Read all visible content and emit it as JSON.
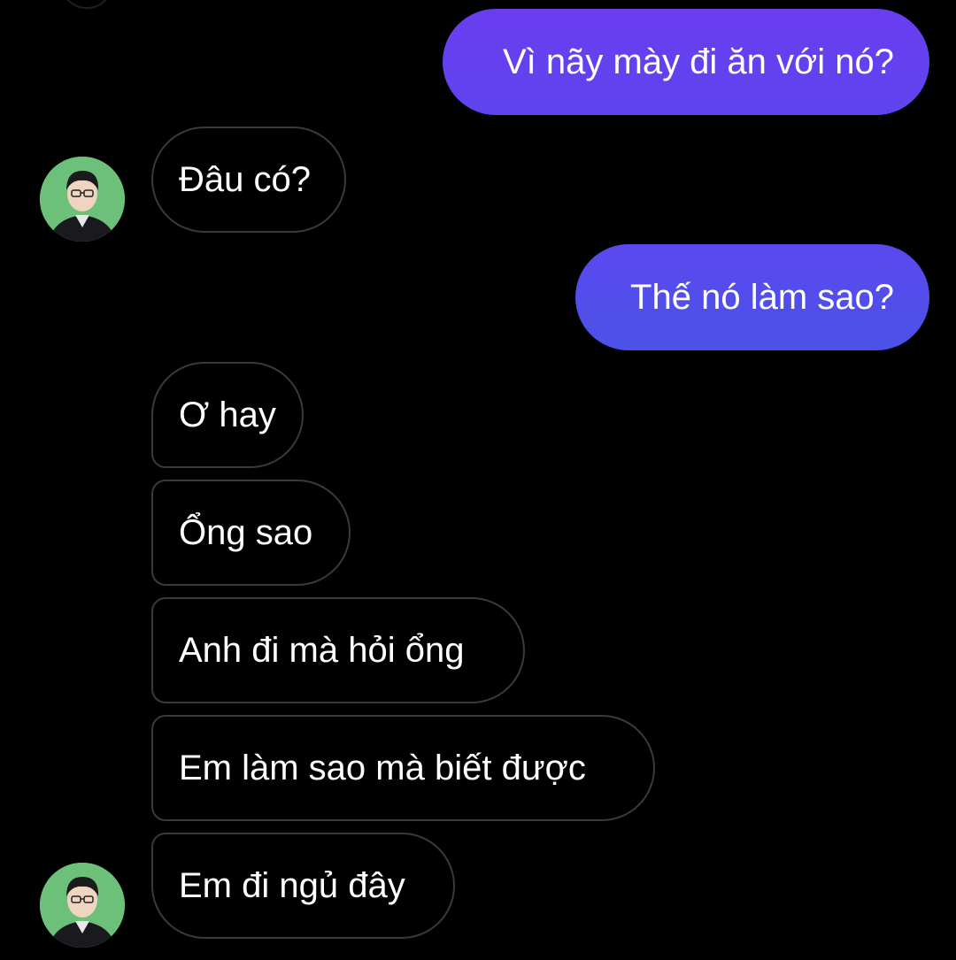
{
  "colors": {
    "background": "#000000",
    "outgoing_gradient_top": "#6a3ef0",
    "outgoing_gradient_bottom": "#4a55e6",
    "incoming_border": "#3a3a3c",
    "text": "#ffffff"
  },
  "messages": [
    {
      "direction": "outgoing",
      "text": "Vì nãy mày đi ăn với nó?"
    },
    {
      "direction": "incoming",
      "text": "Đâu có?",
      "avatar": "contact-avatar"
    },
    {
      "direction": "outgoing",
      "text": "Thế nó làm sao?"
    },
    {
      "direction": "incoming",
      "text": "Ơ hay"
    },
    {
      "direction": "incoming",
      "text": "Ổng sao"
    },
    {
      "direction": "incoming",
      "text": "Anh đi mà hỏi ổng"
    },
    {
      "direction": "incoming",
      "text": "Em làm sao mà biết được"
    },
    {
      "direction": "incoming",
      "text": "Em đi ngủ đây",
      "avatar": "contact-avatar"
    }
  ]
}
